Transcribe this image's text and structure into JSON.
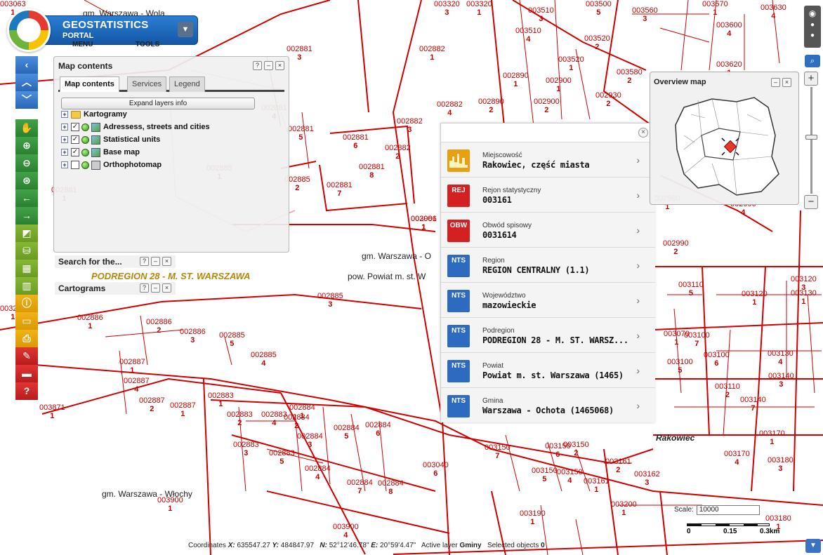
{
  "app": {
    "title": "GEOSTATISTICS",
    "subtitle": "PORTAL",
    "menu_label": "MENU",
    "tools_label": "TOOLS"
  },
  "map_contents": {
    "title": "Map contents",
    "tabs": [
      "Map contents",
      "Services",
      "Legend"
    ],
    "expand_label": "Expand layers info",
    "layers": [
      {
        "label": "Kartogramy",
        "checked": null
      },
      {
        "label": "Adressess, streets and cities",
        "checked": true
      },
      {
        "label": "Statistical units",
        "checked": true
      },
      {
        "label": "Base map",
        "checked": true
      },
      {
        "label": "Orthophotomap",
        "checked": false
      }
    ]
  },
  "search_panel": {
    "title": "Search for the..."
  },
  "cartograms_panel": {
    "title": "Cartograms"
  },
  "popup": {
    "rows": [
      {
        "icon_text": "",
        "icon_color": "#e8a010",
        "label": "Miejscowość",
        "value": "Rakowiec, część miasta"
      },
      {
        "icon_text": "REJ",
        "icon_color": "#d42020",
        "label": "Rejon statystyczny",
        "value": "003161"
      },
      {
        "icon_text": "OBW",
        "icon_color": "#d42020",
        "label": "Obwód spisowy",
        "value": "0031614"
      },
      {
        "icon_text": "NTS",
        "icon_color": "#2c6bbf",
        "label": "Region",
        "value": "REGION CENTRALNY (1.1)"
      },
      {
        "icon_text": "NTS",
        "icon_color": "#2c6bbf",
        "label": "Województwo",
        "value": "mazowieckie"
      },
      {
        "icon_text": "NTS",
        "icon_color": "#2c6bbf",
        "label": "Podregion",
        "value": "PODREGION 28 - M. ST. WARSZ..."
      },
      {
        "icon_text": "NTS",
        "icon_color": "#2c6bbf",
        "label": "Powiat",
        "value": "Powiat m. st. Warszawa (1465)"
      },
      {
        "icon_text": "NTS",
        "icon_color": "#2c6bbf",
        "label": "Gmina",
        "value": "Warszawa - Ochota (1465068)"
      }
    ]
  },
  "overview": {
    "title": "Overview map"
  },
  "status_bar": {
    "coords_label": "Coordinates",
    "x_label": "X:",
    "x_value": "635547.27",
    "y_label": "Y:",
    "y_value": "484847.97",
    "n_label": "N:",
    "n_value": "52°12'46.78\"",
    "e_label": "E:",
    "e_value": "20°59'4.47\"",
    "active_layer_label": "Active layer",
    "active_layer_value": "Gminy",
    "selected_label": "Selected objects",
    "selected_value": "0"
  },
  "scale": {
    "label": "Scale:",
    "value": "10000",
    "ticks": [
      "0",
      "0.15",
      "0.3km"
    ]
  },
  "map": {
    "place_labels": [
      {
        "text": "gm. Warszawa - Wola"
      },
      {
        "text": "gm. Warszawa - Włochy"
      },
      {
        "text": "gm. Warszawa - O"
      },
      {
        "text": "pow. Powiat m. st. W"
      },
      {
        "text": "Rakowiec"
      }
    ],
    "region_label": "PODREGION 28 - M. ST. WARSZAWA",
    "units": [
      {
        "code": "002881",
        "n": "3"
      },
      {
        "code": "002882",
        "n": "1"
      },
      {
        "code": "002881",
        "n": "5"
      },
      {
        "code": "002881",
        "n": "6"
      },
      {
        "code": "002881",
        "n": "8"
      },
      {
        "code": "002881",
        "n": "7"
      },
      {
        "code": "002885",
        "n": "2"
      },
      {
        "code": "002885",
        "n": "1"
      },
      {
        "code": "002881",
        "n": "1"
      },
      {
        "code": "002881",
        "n": "4"
      },
      {
        "code": "002886",
        "n": "1"
      },
      {
        "code": "002886",
        "n": "2"
      },
      {
        "code": "002886",
        "n": "3"
      },
      {
        "code": "002885",
        "n": "5"
      },
      {
        "code": "002885",
        "n": "4"
      },
      {
        "code": "002885",
        "n": "3"
      },
      {
        "code": "002887",
        "n": "1"
      },
      {
        "code": "002887",
        "n": "4"
      },
      {
        "code": "002887",
        "n": "2"
      },
      {
        "code": "002887",
        "n": "1"
      },
      {
        "code": "002883",
        "n": "1"
      },
      {
        "code": "002883",
        "n": "2"
      },
      {
        "code": "002883",
        "n": "4"
      },
      {
        "code": "002883",
        "n": "3"
      },
      {
        "code": "002883",
        "n": "5"
      },
      {
        "code": "002884",
        "n": "1"
      },
      {
        "code": "002884",
        "n": "2"
      },
      {
        "code": "002884",
        "n": "3"
      },
      {
        "code": "002884",
        "n": "5"
      },
      {
        "code": "002884",
        "n": "6"
      },
      {
        "code": "002884",
        "n": "4"
      },
      {
        "code": "002884",
        "n": "7"
      },
      {
        "code": "002884",
        "n": "8"
      },
      {
        "code": "003900",
        "n": "1"
      },
      {
        "code": "003900",
        "n": "4"
      },
      {
        "code": "003871",
        "n": "1"
      },
      {
        "code": "002882",
        "n": "3"
      },
      {
        "code": "002882",
        "n": "2"
      },
      {
        "code": "002882",
        "n": "4"
      },
      {
        "code": "002890",
        "n": "1"
      },
      {
        "code": "002890",
        "n": "2"
      },
      {
        "code": "002900",
        "n": "1"
      },
      {
        "code": "002900",
        "n": "2"
      },
      {
        "code": "003001",
        "n": "1"
      },
      {
        "code": "003040",
        "n": "6"
      },
      {
        "code": "003150",
        "n": "7"
      },
      {
        "code": "003150",
        "n": "5"
      },
      {
        "code": "003150",
        "n": "6"
      },
      {
        "code": "003150",
        "n": "2"
      },
      {
        "code": "003150",
        "n": "4"
      },
      {
        "code": "003161",
        "n": "1"
      },
      {
        "code": "003161",
        "n": "2"
      },
      {
        "code": "003162",
        "n": "3"
      },
      {
        "code": "003190",
        "n": "1"
      },
      {
        "code": "003200",
        "n": "1"
      },
      {
        "code": "003320",
        "n": "3"
      },
      {
        "code": "003320",
        "n": "1"
      },
      {
        "code": "003510",
        "n": "3"
      },
      {
        "code": "003510",
        "n": "4"
      },
      {
        "code": "003520",
        "n": "2"
      },
      {
        "code": "003520",
        "n": "1"
      },
      {
        "code": "003500",
        "n": "5"
      },
      {
        "code": "003560",
        "n": "3"
      },
      {
        "code": "003570",
        "n": "1"
      },
      {
        "code": "003600",
        "n": "4"
      },
      {
        "code": "003630",
        "n": "4"
      },
      {
        "code": "003620",
        "n": "1"
      },
      {
        "code": "003580",
        "n": "2"
      },
      {
        "code": "002930",
        "n": "2"
      },
      {
        "code": "002980",
        "n": "1"
      },
      {
        "code": "002990",
        "n": "4"
      },
      {
        "code": "002990",
        "n": "2"
      },
      {
        "code": "003070",
        "n": "1"
      },
      {
        "code": "003100",
        "n": "7"
      },
      {
        "code": "003100",
        "n": "5"
      },
      {
        "code": "003100",
        "n": "6"
      },
      {
        "code": "003110",
        "n": "2"
      },
      {
        "code": "003110",
        "n": "5"
      },
      {
        "code": "003120",
        "n": "1"
      },
      {
        "code": "003120",
        "n": "3"
      },
      {
        "code": "003130",
        "n": "1"
      },
      {
        "code": "003130",
        "n": "4"
      },
      {
        "code": "003140",
        "n": "3"
      },
      {
        "code": "003140",
        "n": "7"
      },
      {
        "code": "003170",
        "n": "1"
      },
      {
        "code": "003170",
        "n": "4"
      },
      {
        "code": "003180",
        "n": "3"
      },
      {
        "code": "003180",
        "n": "1"
      },
      {
        "code": "003240",
        "n": "1"
      },
      {
        "code": "002986",
        "n": "1"
      },
      {
        "code": "003063",
        "n": "1"
      }
    ]
  }
}
